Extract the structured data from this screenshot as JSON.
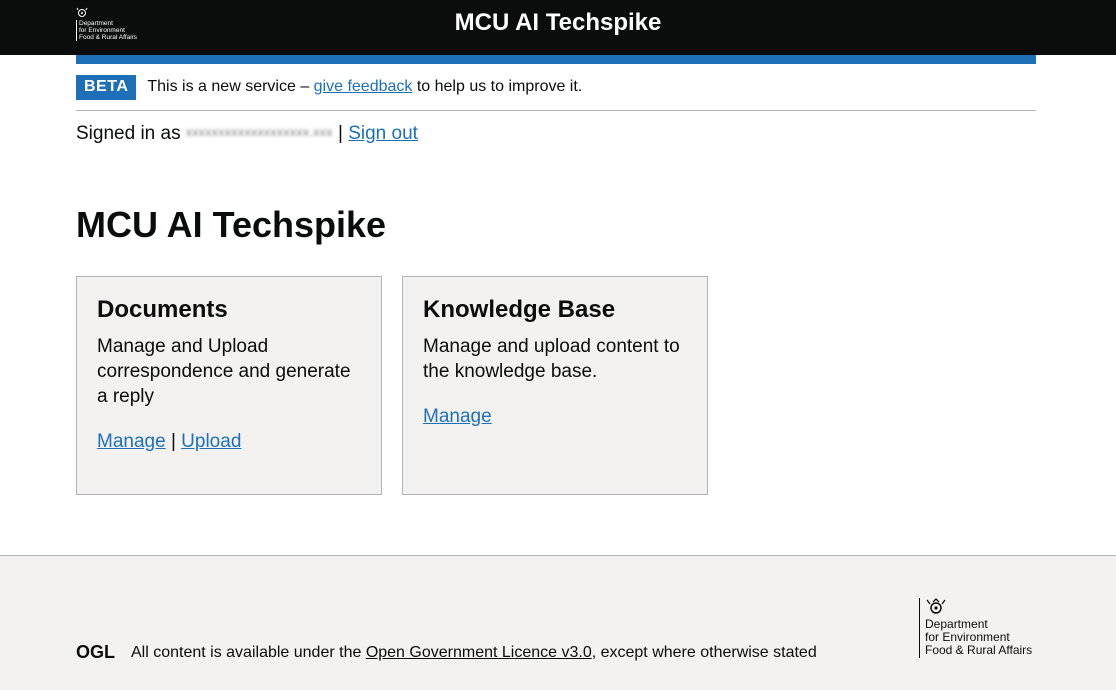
{
  "header": {
    "logo_lines": [
      "Department",
      "for Environment",
      "Food & Rural Affairs"
    ],
    "service_name": "MCU AI Techspike"
  },
  "phase_banner": {
    "tag": "BETA",
    "text_before": "This is a new service – ",
    "link": "give feedback",
    "text_after": " to help us to improve it."
  },
  "account": {
    "signed_in_prefix": "Signed in as",
    "email_redacted": "xxxxxxxxxxxxxxxxxxx.xxx",
    "separator": "|",
    "sign_out": "Sign out"
  },
  "main": {
    "title": "MCU AI Techspike",
    "cards": [
      {
        "heading": "Documents",
        "description": "Manage and Upload correspondence and generate a reply",
        "links": [
          "Manage",
          "Upload"
        ],
        "separator": "|"
      },
      {
        "heading": "Knowledge Base",
        "description": "Manage and upload content to the knowledge base.",
        "links": [
          "Manage"
        ]
      }
    ]
  },
  "footer": {
    "ogl_label": "OGL",
    "licence_prefix": "All content is available under the ",
    "licence_link": "Open Government Licence v3.0",
    "licence_suffix": ", except where otherwise stated",
    "logo_lines": [
      "Department",
      "for Environment",
      "Food & Rural Affairs"
    ]
  },
  "colors": {
    "header_bg": "#0b0c0c",
    "brand_blue": "#1d70b8",
    "card_bg": "#f3f2f1",
    "border": "#b1b4b6",
    "footer_bg": "#f3f2f1"
  },
  "icons": [
    "royal-crest-icon",
    "ogl-logo-icon"
  ]
}
